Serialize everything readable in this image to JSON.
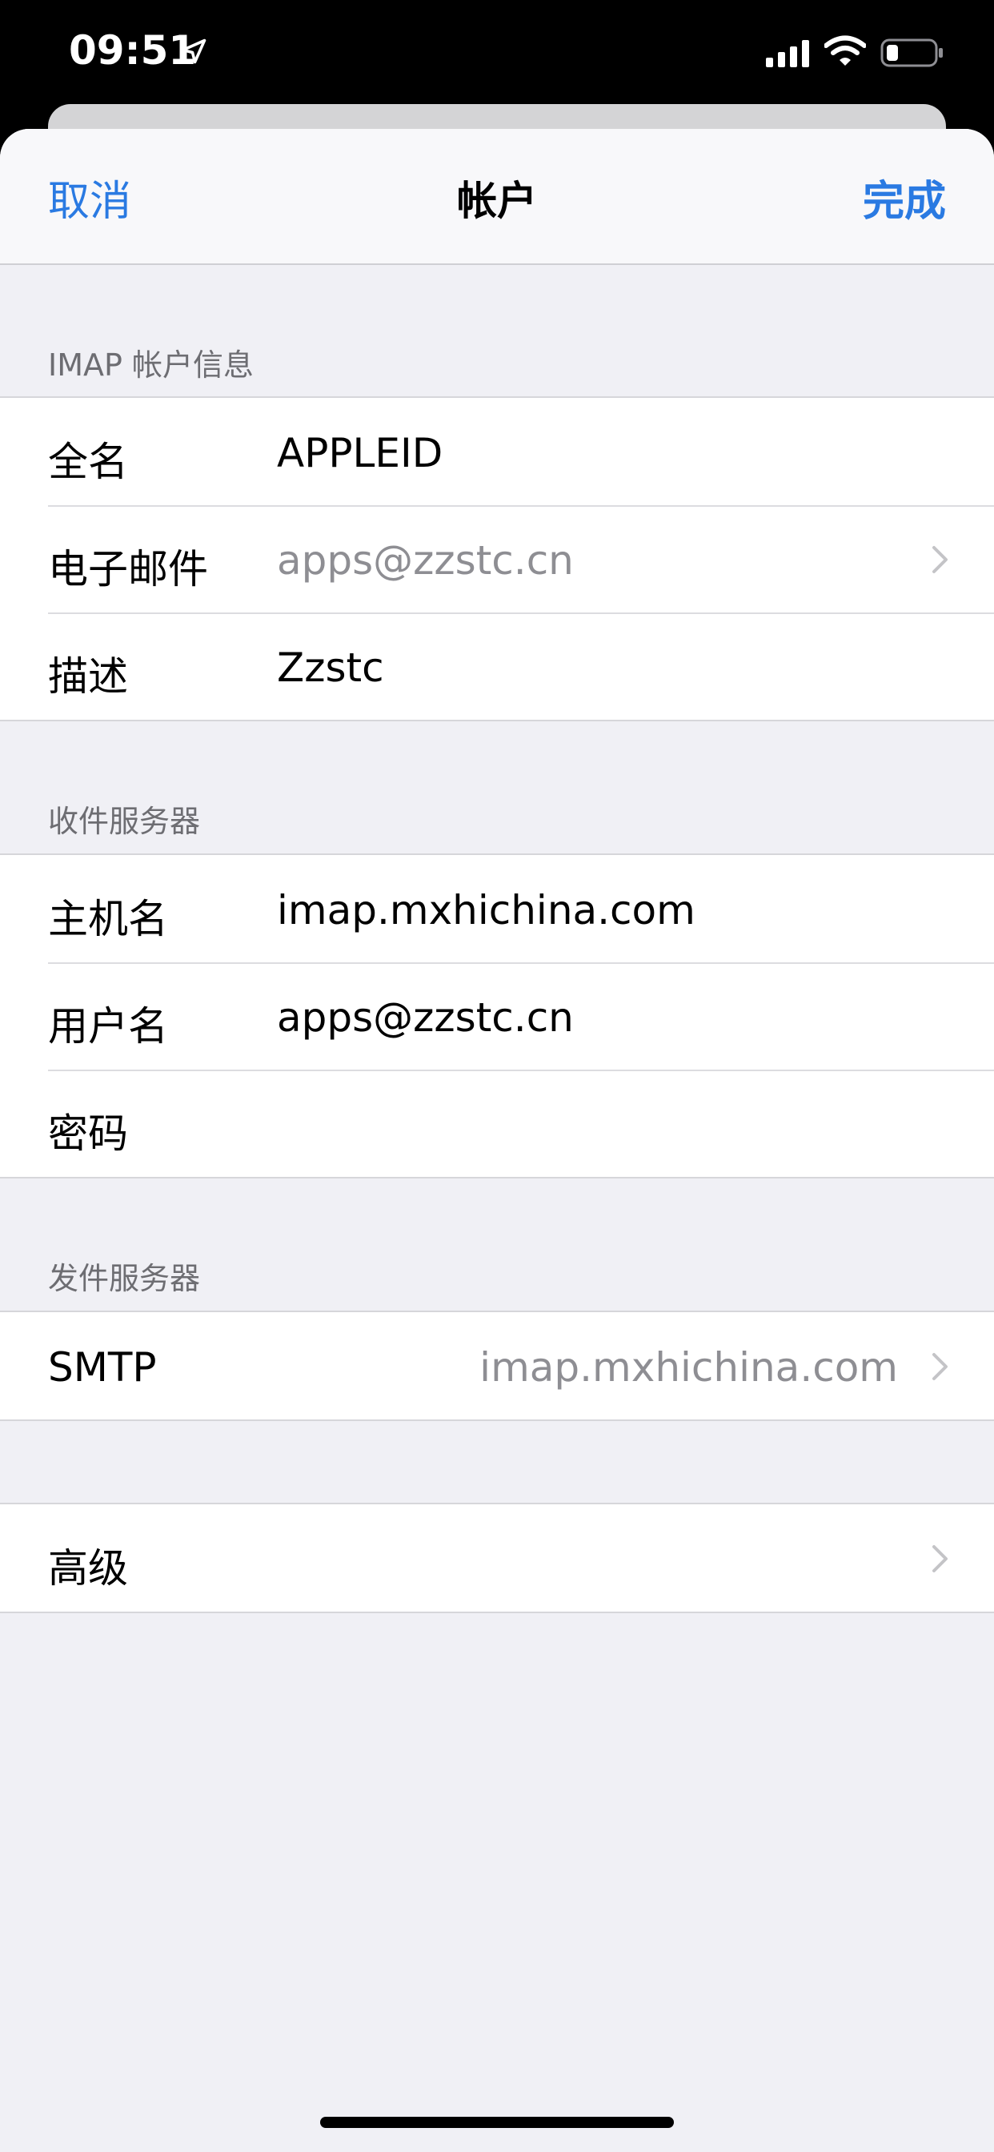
{
  "status_bar": {
    "time": "09:51",
    "icons": [
      "location-arrow-icon",
      "cellular-signal-icon",
      "wifi-icon",
      "battery-icon"
    ]
  },
  "navbar": {
    "cancel_label": "取消",
    "title": "帐户",
    "done_label": "完成",
    "accent_color": "#2a7ae2"
  },
  "imap_section": {
    "header": "IMAP 帐户信息",
    "rows": [
      {
        "label": "全名",
        "value": "APPLEID"
      },
      {
        "label": "电子邮件",
        "value": "apps@zzstc.cn"
      },
      {
        "label": "描述",
        "value": "Zzstc"
      }
    ]
  },
  "incoming_section": {
    "header": "收件服务器",
    "rows": [
      {
        "label": "主机名",
        "value": "imap.mxhichina.com"
      },
      {
        "label": "用户名",
        "value": "apps@zzstc.cn"
      },
      {
        "label": "密码",
        "value": ""
      }
    ]
  },
  "outgoing_section": {
    "header": "发件服务器",
    "smtp_label": "SMTP",
    "smtp_value": "imap.mxhichina.com"
  },
  "advanced": {
    "label": "高级"
  }
}
